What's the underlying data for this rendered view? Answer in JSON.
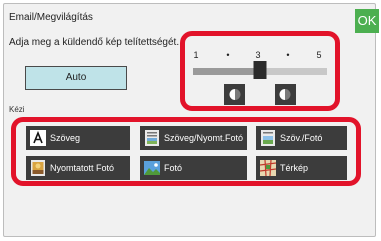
{
  "header": {
    "title": "Email/Megvilágítás",
    "ok_label": "OK"
  },
  "instruction": "Adja meg a küldendő kép telítettségét.",
  "auto_button": {
    "label": "Auto"
  },
  "exposure": {
    "scale_labels": [
      "1",
      "•",
      "3",
      "•",
      "5"
    ],
    "min": 1,
    "max": 5,
    "value": 3,
    "decrease_icon": "half-moon-left-icon",
    "increase_icon": "half-moon-right-icon"
  },
  "manual": {
    "label": "Kézi",
    "modes": [
      {
        "label": "Szöveg",
        "icon": "text-mode-icon"
      },
      {
        "label": "Szöveg/Nyomt.Fotó",
        "icon": "text-printed-photo-icon"
      },
      {
        "label": "Szöv./Fotó",
        "icon": "text-photo-icon"
      },
      {
        "label": "Nyomtatott Fotó",
        "icon": "printed-photo-icon"
      },
      {
        "label": "Fotó",
        "icon": "photo-icon"
      },
      {
        "label": "Térkép",
        "icon": "map-icon"
      }
    ]
  },
  "colors": {
    "highlight": "#e2132a",
    "ok": "#4caf50",
    "auto": "#bfe3e8",
    "button": "#3c3c3c"
  }
}
